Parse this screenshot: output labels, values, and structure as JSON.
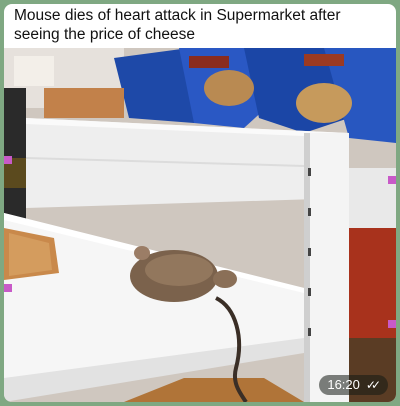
{
  "message": {
    "caption": "Mouse dies of heart attack in Supermarket after seeing the price of cheese",
    "time": "16:20",
    "read_status_icon": "double-check-icon"
  },
  "colors": {
    "chat_background": "#7fa882",
    "bubble": "#ffffff",
    "shelf": "#f2f2f2",
    "bag_blue": "#1f4fb3"
  }
}
